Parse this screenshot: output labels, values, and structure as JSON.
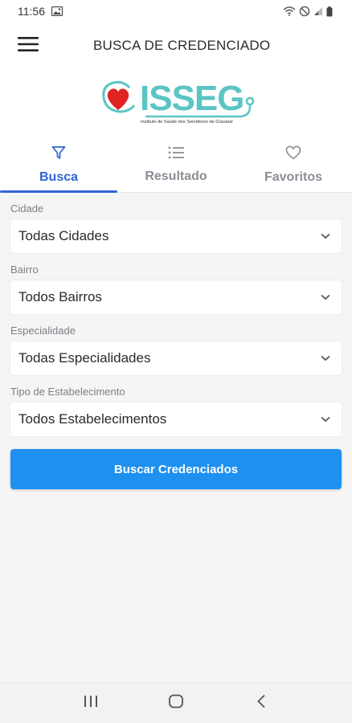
{
  "status_bar": {
    "time": "11:56",
    "icons": [
      "image-icon",
      "wifi-icon",
      "do-not-disturb-icon",
      "signal-icon",
      "battery-icon"
    ]
  },
  "app_bar": {
    "title": "BUSCA DE CREDENCIADO",
    "menu_icon": "hamburger-menu-icon"
  },
  "logo": {
    "name": "ISSEG",
    "tagline": "Instituto de Saúde dos Servidores de Gravataí",
    "colors": {
      "teal": "#5cc4c4",
      "heart": "#e02424"
    }
  },
  "tabs": [
    {
      "label": "Busca",
      "icon": "filter-icon",
      "active": true
    },
    {
      "label": "Resultado",
      "icon": "list-icon",
      "active": false
    },
    {
      "label": "Favoritos",
      "icon": "heart-outline-icon",
      "active": false
    }
  ],
  "form": {
    "fields": [
      {
        "label": "Cidade",
        "value": "Todas Cidades"
      },
      {
        "label": "Bairro",
        "value": "Todos Bairros"
      },
      {
        "label": "Especialidade",
        "value": "Todas Especialidades"
      },
      {
        "label": "Tipo de Estabelecimento",
        "value": "Todos Estabelecimentos"
      }
    ],
    "submit_label": "Buscar Credenciados"
  },
  "theme": {
    "primary": "#2f66d8",
    "button": "#1e90f0",
    "background": "#f5f5f5"
  }
}
